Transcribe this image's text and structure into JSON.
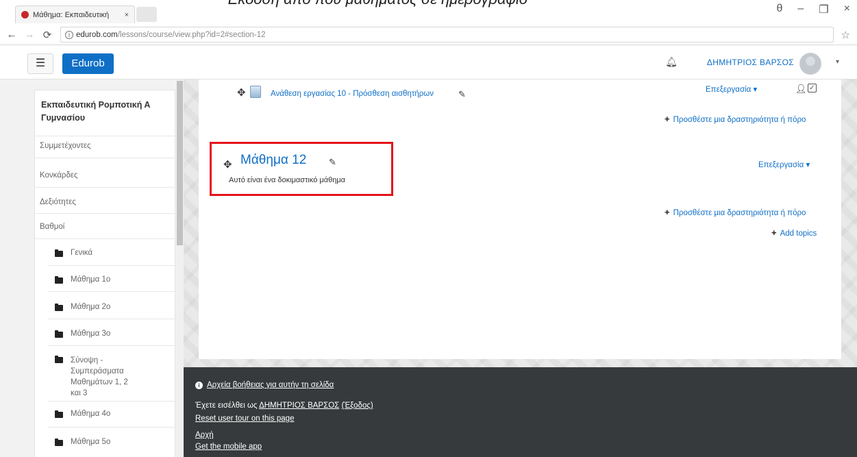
{
  "page_heading_cut": "Έκδοση από που μαθήματος σε ημερογράφιο",
  "browser": {
    "tab_title": "Μάθημα: Εκπαιδευτική",
    "tab_close": "×",
    "url_domain": "edurob.com",
    "url_path": "/lessons/course/view.php?id=2#section-12",
    "window_controls": [
      "θ",
      "–",
      "❐",
      "×"
    ]
  },
  "navbar": {
    "brand": "Edurob",
    "menu_icon": "☰",
    "user_name": "ΔΗΜΗΤΡΙΟΣ ΒΑΡΣΟΣ"
  },
  "sidebar": {
    "course_title": "Εκπαιδευτική Ρομποτική Α Γυμνασίου",
    "links": [
      "Συμμετέχοντες",
      "Κονκάρδες",
      "Δεξιότητες",
      "Βαθμοί"
    ],
    "folders": [
      "Γενικά",
      "Μάθημα 1ο",
      "Μάθημα 2ο",
      "Μάθημα 3ο",
      "Σύνοψη - Συμπεράσματα Μαθημάτων 1, 2 και 3",
      "Μάθημα 4ο",
      "Μάθημα 5ο"
    ]
  },
  "content": {
    "activity_link": "Ανάθεση εργασίας 10 - Πρόσθεση αισθητήρων",
    "edit_menu": "Επεξεργασία",
    "add_activity": "Προσθέστε μια δραστηριότητα ή πόρο",
    "section_title": "Μάθημα 12",
    "section_summary": "Αυτό είναι ένα δοκιμαστικό μάθημα",
    "add_topics": "Add topics"
  },
  "footer": {
    "help_link": "Αρχεία βοήθειας για αυτήν τη σελίδα",
    "logged_in_prefix": "Έχετε εισέλθει ως",
    "logged_in_user": "ΔΗΜΗΤΡΙΟΣ ΒΑΡΣΟΣ",
    "logout": "(Έξοδος)",
    "reset_tour": "Reset user tour on this page",
    "home": "Αρχή",
    "mobile_app": "Get the mobile app"
  },
  "colors": {
    "link_blue": "#0f6fc6",
    "highlight_red": "#e4121a",
    "footer_bg": "#373a3c"
  }
}
